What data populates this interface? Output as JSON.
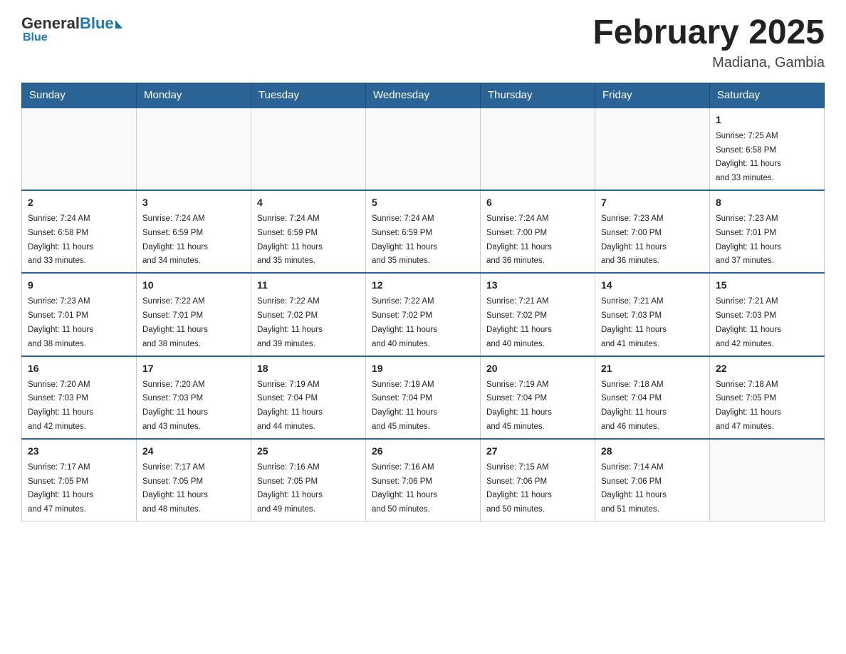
{
  "logo": {
    "general": "General",
    "blue": "Blue"
  },
  "title": "February 2025",
  "location": "Madiana, Gambia",
  "days_of_week": [
    "Sunday",
    "Monday",
    "Tuesday",
    "Wednesday",
    "Thursday",
    "Friday",
    "Saturday"
  ],
  "weeks": [
    [
      {
        "day": "",
        "info": ""
      },
      {
        "day": "",
        "info": ""
      },
      {
        "day": "",
        "info": ""
      },
      {
        "day": "",
        "info": ""
      },
      {
        "day": "",
        "info": ""
      },
      {
        "day": "",
        "info": ""
      },
      {
        "day": "1",
        "info": "Sunrise: 7:25 AM\nSunset: 6:58 PM\nDaylight: 11 hours\nand 33 minutes."
      }
    ],
    [
      {
        "day": "2",
        "info": "Sunrise: 7:24 AM\nSunset: 6:58 PM\nDaylight: 11 hours\nand 33 minutes."
      },
      {
        "day": "3",
        "info": "Sunrise: 7:24 AM\nSunset: 6:59 PM\nDaylight: 11 hours\nand 34 minutes."
      },
      {
        "day": "4",
        "info": "Sunrise: 7:24 AM\nSunset: 6:59 PM\nDaylight: 11 hours\nand 35 minutes."
      },
      {
        "day": "5",
        "info": "Sunrise: 7:24 AM\nSunset: 6:59 PM\nDaylight: 11 hours\nand 35 minutes."
      },
      {
        "day": "6",
        "info": "Sunrise: 7:24 AM\nSunset: 7:00 PM\nDaylight: 11 hours\nand 36 minutes."
      },
      {
        "day": "7",
        "info": "Sunrise: 7:23 AM\nSunset: 7:00 PM\nDaylight: 11 hours\nand 36 minutes."
      },
      {
        "day": "8",
        "info": "Sunrise: 7:23 AM\nSunset: 7:01 PM\nDaylight: 11 hours\nand 37 minutes."
      }
    ],
    [
      {
        "day": "9",
        "info": "Sunrise: 7:23 AM\nSunset: 7:01 PM\nDaylight: 11 hours\nand 38 minutes."
      },
      {
        "day": "10",
        "info": "Sunrise: 7:22 AM\nSunset: 7:01 PM\nDaylight: 11 hours\nand 38 minutes."
      },
      {
        "day": "11",
        "info": "Sunrise: 7:22 AM\nSunset: 7:02 PM\nDaylight: 11 hours\nand 39 minutes."
      },
      {
        "day": "12",
        "info": "Sunrise: 7:22 AM\nSunset: 7:02 PM\nDaylight: 11 hours\nand 40 minutes."
      },
      {
        "day": "13",
        "info": "Sunrise: 7:21 AM\nSunset: 7:02 PM\nDaylight: 11 hours\nand 40 minutes."
      },
      {
        "day": "14",
        "info": "Sunrise: 7:21 AM\nSunset: 7:03 PM\nDaylight: 11 hours\nand 41 minutes."
      },
      {
        "day": "15",
        "info": "Sunrise: 7:21 AM\nSunset: 7:03 PM\nDaylight: 11 hours\nand 42 minutes."
      }
    ],
    [
      {
        "day": "16",
        "info": "Sunrise: 7:20 AM\nSunset: 7:03 PM\nDaylight: 11 hours\nand 42 minutes."
      },
      {
        "day": "17",
        "info": "Sunrise: 7:20 AM\nSunset: 7:03 PM\nDaylight: 11 hours\nand 43 minutes."
      },
      {
        "day": "18",
        "info": "Sunrise: 7:19 AM\nSunset: 7:04 PM\nDaylight: 11 hours\nand 44 minutes."
      },
      {
        "day": "19",
        "info": "Sunrise: 7:19 AM\nSunset: 7:04 PM\nDaylight: 11 hours\nand 45 minutes."
      },
      {
        "day": "20",
        "info": "Sunrise: 7:19 AM\nSunset: 7:04 PM\nDaylight: 11 hours\nand 45 minutes."
      },
      {
        "day": "21",
        "info": "Sunrise: 7:18 AM\nSunset: 7:04 PM\nDaylight: 11 hours\nand 46 minutes."
      },
      {
        "day": "22",
        "info": "Sunrise: 7:18 AM\nSunset: 7:05 PM\nDaylight: 11 hours\nand 47 minutes."
      }
    ],
    [
      {
        "day": "23",
        "info": "Sunrise: 7:17 AM\nSunset: 7:05 PM\nDaylight: 11 hours\nand 47 minutes."
      },
      {
        "day": "24",
        "info": "Sunrise: 7:17 AM\nSunset: 7:05 PM\nDaylight: 11 hours\nand 48 minutes."
      },
      {
        "day": "25",
        "info": "Sunrise: 7:16 AM\nSunset: 7:05 PM\nDaylight: 11 hours\nand 49 minutes."
      },
      {
        "day": "26",
        "info": "Sunrise: 7:16 AM\nSunset: 7:06 PM\nDaylight: 11 hours\nand 50 minutes."
      },
      {
        "day": "27",
        "info": "Sunrise: 7:15 AM\nSunset: 7:06 PM\nDaylight: 11 hours\nand 50 minutes."
      },
      {
        "day": "28",
        "info": "Sunrise: 7:14 AM\nSunset: 7:06 PM\nDaylight: 11 hours\nand 51 minutes."
      },
      {
        "day": "",
        "info": ""
      }
    ]
  ]
}
